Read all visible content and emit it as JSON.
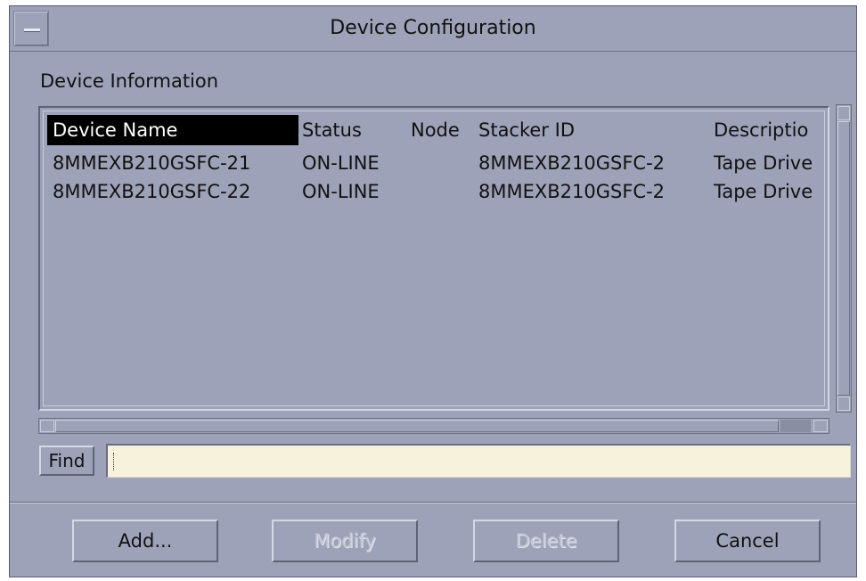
{
  "window": {
    "title": "Device Configuration"
  },
  "section_label": "Device Information",
  "table": {
    "columns": [
      "Device Name",
      "Status",
      "Node",
      "Stacker ID",
      "Descriptio"
    ],
    "rows": [
      [
        "8MMEXB210GSFC-21",
        "ON-LINE",
        "",
        "8MMEXB210GSFC-2",
        "Tape Drive"
      ],
      [
        "8MMEXB210GSFC-22",
        "ON-LINE",
        "",
        "8MMEXB210GSFC-2",
        "Tape Drive"
      ]
    ],
    "selected_header": "Device Name"
  },
  "find": {
    "button_label": "Find",
    "input_value": ""
  },
  "buttons": {
    "add": "Add...",
    "modify": "Modify",
    "delete": "Delete",
    "cancel": "Cancel"
  },
  "icons": {
    "window_menu": "window-menu-icon",
    "scroll_up": "arrow-up-icon",
    "scroll_down": "arrow-down-icon",
    "scroll_left": "arrow-left-icon",
    "scroll_right": "arrow-right-icon"
  }
}
